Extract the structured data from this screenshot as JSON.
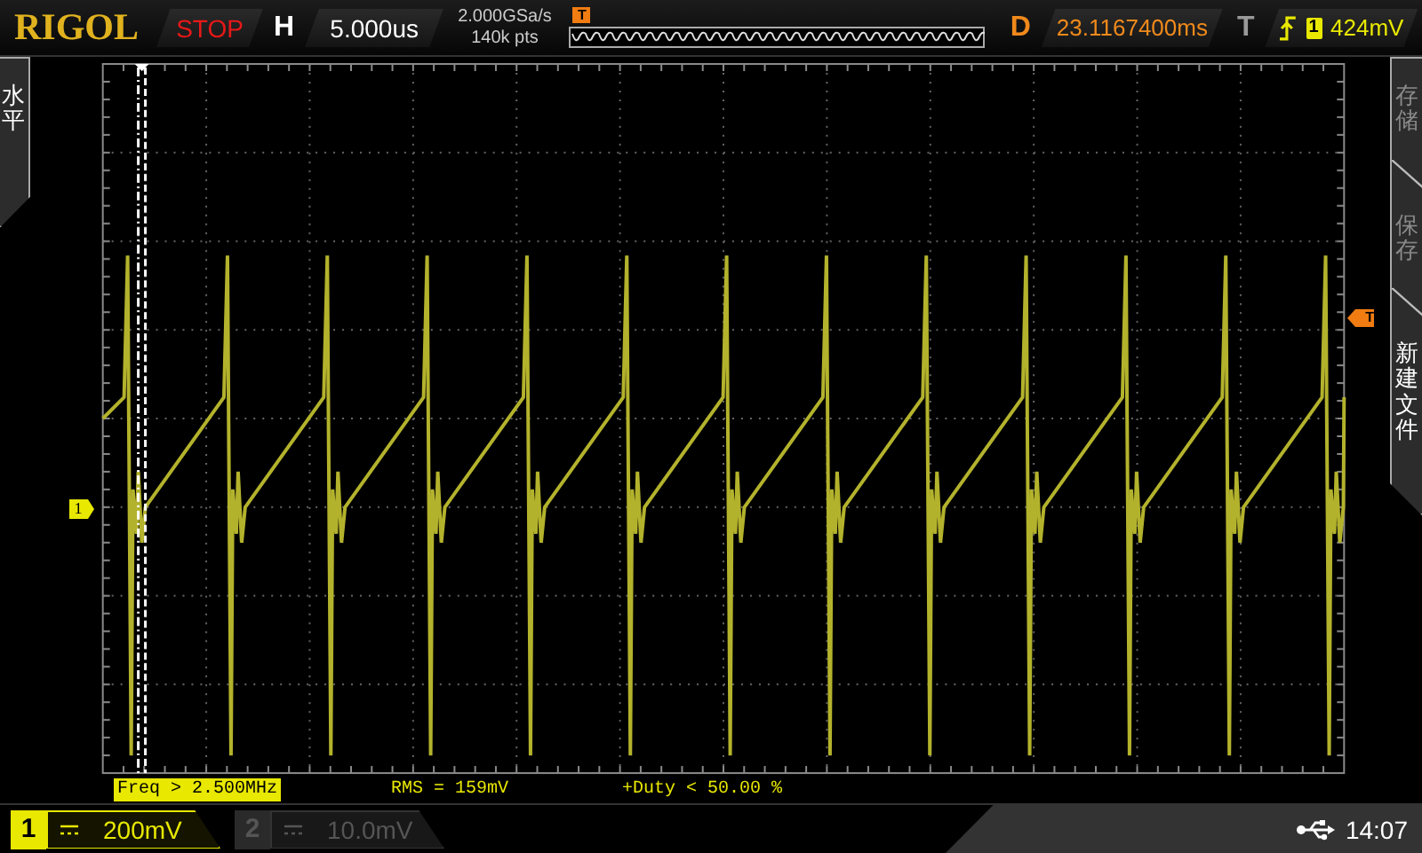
{
  "header": {
    "brand": "RIGOL",
    "run_state": "STOP",
    "timebase_label": "H",
    "timebase": "5.000us",
    "sample_rate": "2.000GSa/s",
    "memory_depth": "140k pts",
    "strip_trigger_marker": "T",
    "delay_label": "D",
    "delay": "23.1167400ms",
    "trigger_label": "T",
    "trigger_source": "1",
    "trigger_level": "424mV"
  },
  "left_menu": {
    "label": "水平"
  },
  "right_menu": {
    "items": [
      {
        "label": "存储",
        "disabled": true
      },
      {
        "label": "保存",
        "disabled": true
      },
      {
        "label": "新建文件",
        "disabled": false
      }
    ]
  },
  "channel_marker": "1",
  "trigger_marker": "T",
  "measurements": [
    {
      "text": "Freq > 2.500MHz",
      "selected": true
    },
    {
      "text": "RMS = 159mV",
      "selected": false
    },
    {
      "text": "+Duty < 50.00 %",
      "selected": false
    }
  ],
  "channels": [
    {
      "number": "1",
      "scale": "200mV",
      "on": true
    },
    {
      "number": "2",
      "scale": "10.0mV",
      "on": false
    }
  ],
  "status": {
    "time": "14:07"
  }
}
